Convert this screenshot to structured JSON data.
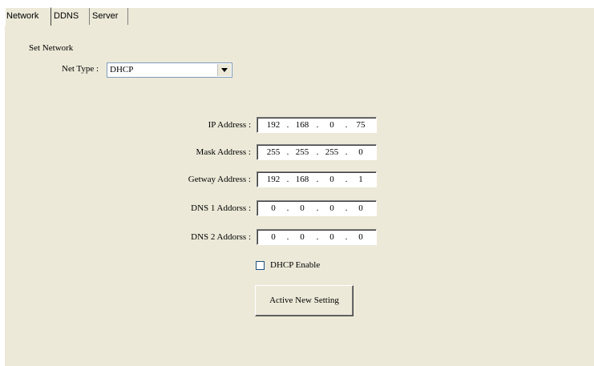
{
  "tabs": [
    {
      "label": "Network",
      "active": true
    },
    {
      "label": "DDNS",
      "active": false
    },
    {
      "label": "Server",
      "active": false
    }
  ],
  "network": {
    "section_title": "Set Network",
    "net_type_label": "Net Type :",
    "net_type_value": "DHCP",
    "fields": [
      {
        "label": "IP Address :",
        "octets": [
          "192",
          "168",
          "0",
          "75"
        ]
      },
      {
        "label": "Mask Address :",
        "octets": [
          "255",
          "255",
          "255",
          "0"
        ]
      },
      {
        "label": "Getway Address :",
        "octets": [
          "192",
          "168",
          "0",
          "1"
        ]
      },
      {
        "label": "DNS 1 Addorss :",
        "octets": [
          "0",
          "0",
          "0",
          "0"
        ]
      },
      {
        "label": "DNS 2 Addorss :",
        "octets": [
          "0",
          "0",
          "0",
          "0"
        ]
      }
    ],
    "dhcp_enable_label": "DHCP Enable",
    "dhcp_enable_checked": false,
    "apply_button": "Active New Setting"
  },
  "colors": {
    "panel_bg": "#ece9d8",
    "input_border": "#7f9db9"
  },
  "icons": {
    "dropdown": "chevron-down-icon"
  }
}
